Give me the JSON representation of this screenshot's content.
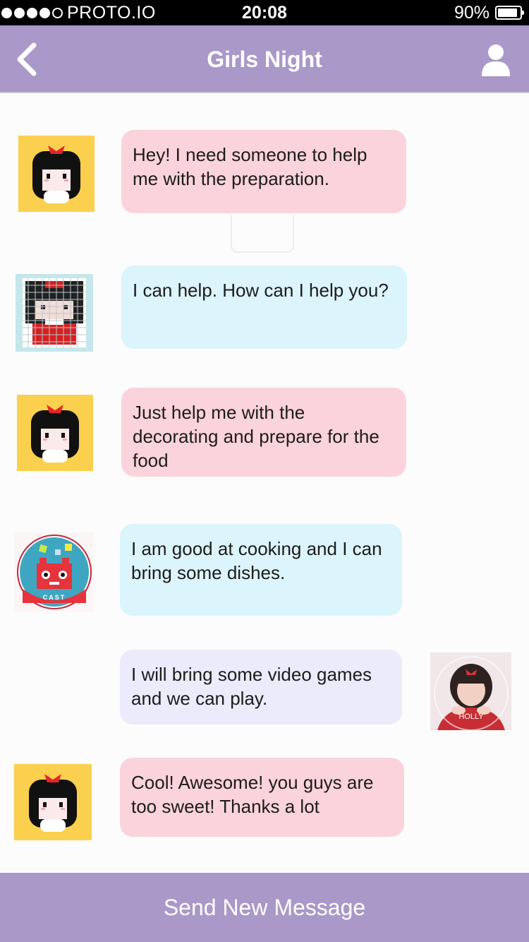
{
  "status_bar": {
    "carrier": "PROTO.IO",
    "time": "20:08",
    "battery_percent": "90%",
    "signal_bars_filled": 4,
    "signal_bars_total": 5
  },
  "nav": {
    "title": "Girls Night",
    "back_icon": "chevron-left-icon",
    "profile_icon": "user-icon"
  },
  "colors": {
    "nav_background": "#a998c8",
    "bubble_pink": "#fbd3dc",
    "bubble_blue": "#dcf4fb",
    "bubble_lavender": "#ecebfb"
  },
  "messages": [
    {
      "sender": "girl-avatar",
      "text": "Hey! I need someone to help me with the preparation.",
      "color": "pink",
      "side": "left"
    },
    {
      "sender": "pixel-girl-avatar",
      "text": "I can help. How can I help you?",
      "color": "blue",
      "side": "left"
    },
    {
      "sender": "girl-avatar",
      "text": "Just help me with the decorating and prepare for the food",
      "color": "pink",
      "side": "left"
    },
    {
      "sender": "robot-avatar",
      "text": "I am good at cooking and I can bring some dishes.",
      "color": "blue",
      "side": "left"
    },
    {
      "sender": "photo-avatar",
      "text": "I will bring some video games and we can play.",
      "color": "lavender",
      "side": "right"
    },
    {
      "sender": "girl-avatar",
      "text": "Cool! Awesome! you guys are too sweet! Thanks a lot",
      "color": "pink",
      "side": "left"
    }
  ],
  "avatar_labels": {
    "robot": "CAST",
    "photo": "HOLLY"
  },
  "footer": {
    "send_label": "Send New Message"
  }
}
